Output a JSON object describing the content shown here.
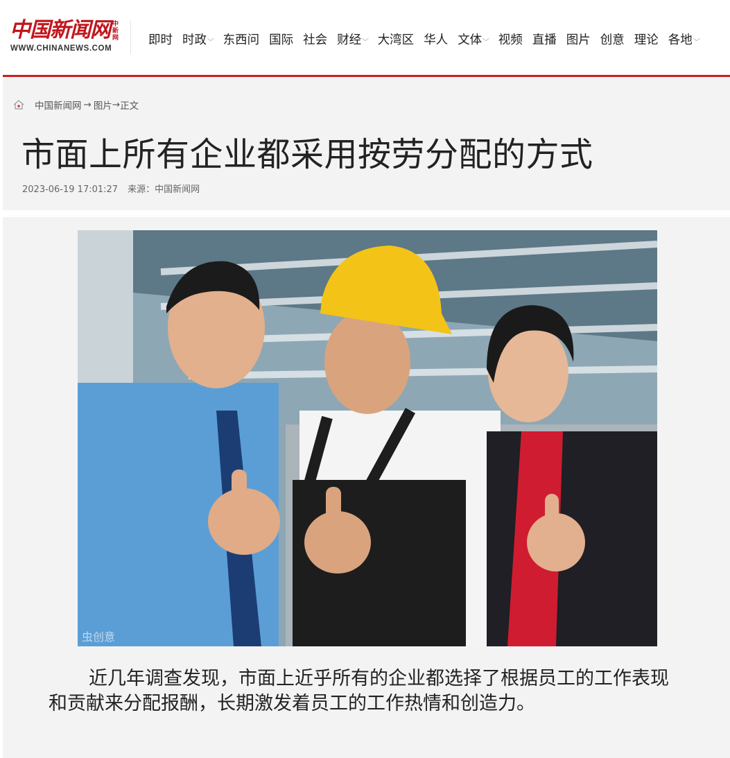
{
  "site": {
    "logo_cn": "中国新闻网",
    "logo_side": "中新网",
    "logo_url": "WWW.CHINANEWS.COM",
    "accent_color": "#c91c22"
  },
  "nav": {
    "items": [
      {
        "label": "即时",
        "has_dropdown": false
      },
      {
        "label": "时政",
        "has_dropdown": true
      },
      {
        "label": "东西问",
        "has_dropdown": false
      },
      {
        "label": "国际",
        "has_dropdown": false
      },
      {
        "label": "社会",
        "has_dropdown": false
      },
      {
        "label": "财经",
        "has_dropdown": true
      },
      {
        "label": "大湾区",
        "has_dropdown": false
      },
      {
        "label": "华人",
        "has_dropdown": false
      },
      {
        "label": "文体",
        "has_dropdown": true
      },
      {
        "label": "视频",
        "has_dropdown": false
      },
      {
        "label": "直播",
        "has_dropdown": false
      },
      {
        "label": "图片",
        "has_dropdown": false
      },
      {
        "label": "创意",
        "has_dropdown": false
      },
      {
        "label": "理论",
        "has_dropdown": false
      },
      {
        "label": "各地",
        "has_dropdown": true
      }
    ],
    "chevron": "⌵"
  },
  "breadcrumb": {
    "icon": "home-icon",
    "items": [
      "中国新闻网",
      "图片",
      "正文"
    ],
    "sep1": " → ",
    "sep2": "→"
  },
  "article": {
    "title": "市面上所有企业都采用按劳分配的方式",
    "datetime": "2023-06-19 17:01:27",
    "source": "来源：中国新闻网",
    "watermark": "虫创意",
    "body": "近几年调查发现，市面上近乎所有的企业都选择了根据员工的工作表现和贡献来分配报酬，长期激发着员工的工作热情和创造力。"
  }
}
